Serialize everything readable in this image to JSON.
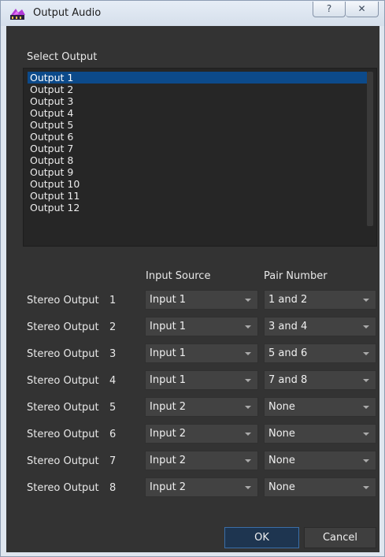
{
  "window": {
    "title": "Output Audio",
    "help_glyph": "?",
    "close_glyph": "✕"
  },
  "select_output": {
    "label": "Select Output",
    "items": [
      "Output 1",
      "Output 2",
      "Output 3",
      "Output 4",
      "Output 5",
      "Output 6",
      "Output 7",
      "Output 8",
      "Output 9",
      "Output 10",
      "Output 11",
      "Output 12"
    ],
    "selected": "Output 1"
  },
  "columns": {
    "input_source": "Input Source",
    "pair_number": "Pair Number"
  },
  "rows": [
    {
      "label": "Stereo Output",
      "num": "1",
      "input": "Input 1",
      "pair": "1 and 2"
    },
    {
      "label": "Stereo Output",
      "num": "2",
      "input": "Input 1",
      "pair": "3 and 4"
    },
    {
      "label": "Stereo Output",
      "num": "3",
      "input": "Input 1",
      "pair": "5 and 6"
    },
    {
      "label": "Stereo Output",
      "num": "4",
      "input": "Input 1",
      "pair": "7 and 8"
    },
    {
      "label": "Stereo Output",
      "num": "5",
      "input": "Input 2",
      "pair": "None"
    },
    {
      "label": "Stereo Output",
      "num": "6",
      "input": "Input 2",
      "pair": "None"
    },
    {
      "label": "Stereo Output",
      "num": "7",
      "input": "Input 2",
      "pair": "None"
    },
    {
      "label": "Stereo Output",
      "num": "8",
      "input": "Input 2",
      "pair": "None"
    }
  ],
  "buttons": {
    "ok": "OK",
    "cancel": "Cancel"
  },
  "colors": {
    "dialog_bg": "#333333",
    "selection": "#0c4a8a",
    "combo_bg": "#424242",
    "ok_border": "#3a6ea8"
  }
}
